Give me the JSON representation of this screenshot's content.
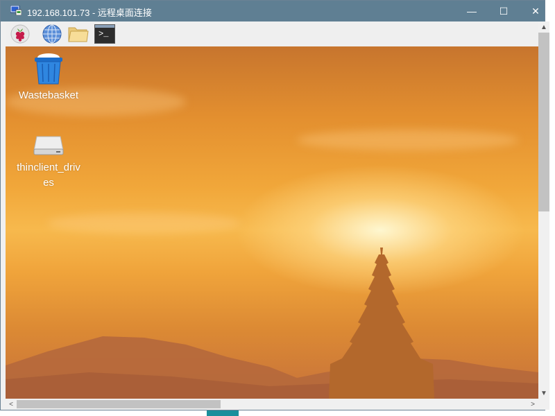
{
  "window": {
    "title": "192.168.101.73 - 远程桌面连接",
    "minimize_glyph": "—",
    "maximize_glyph": "☐",
    "close_glyph": "✕"
  },
  "taskbar": {
    "icons": [
      "raspberry-pi-menu-icon",
      "web-browser-globe-icon",
      "file-manager-folder-icon",
      "terminal-icon"
    ],
    "terminal_prompt": ">_"
  },
  "desktop": {
    "icons": [
      {
        "name": "wastebasket-icon",
        "label": "Wastebasket"
      },
      {
        "name": "drive-icon",
        "label_line1": "thinclient_driv",
        "label_line2": "es"
      }
    ]
  },
  "scrollbars": {
    "up_arrow": "▲",
    "down_arrow": "▼",
    "left_arrow": "<",
    "right_arrow": ">",
    "vertical_scrolled_fraction": 0.0,
    "horizontal_scrolled_fraction": 0.0
  },
  "colors": {
    "titlebar": "#5f7f93",
    "sky_top": "#c7752e",
    "sky_sun": "#f7b94d"
  }
}
